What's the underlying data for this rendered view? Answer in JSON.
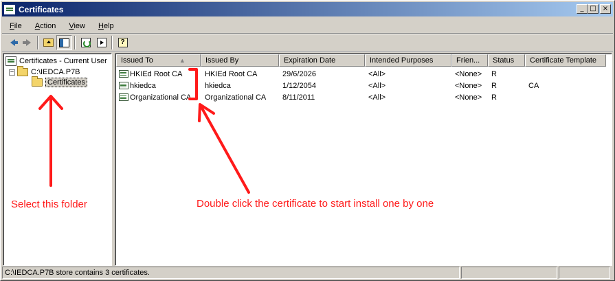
{
  "window": {
    "title": "Certificates",
    "controls": {
      "minimize": "_",
      "maximize": "□",
      "close": "×"
    }
  },
  "menu": [
    {
      "label": "File",
      "accel": "F",
      "rest": "ile"
    },
    {
      "label": "Action",
      "accel": "A",
      "rest": "ction"
    },
    {
      "label": "View",
      "accel": "V",
      "rest": "iew"
    },
    {
      "label": "Help",
      "accel": "H",
      "rest": "elp"
    }
  ],
  "tree": {
    "root": "Certificates - Current User",
    "file": "C:\\IEDCA.P7B",
    "folder": "Certificates",
    "expander": "−"
  },
  "columns": [
    "Issued To",
    "Issued By",
    "Expiration Date",
    "Intended Purposes",
    "Frien...",
    "Status",
    "Certificate Template"
  ],
  "sort_indicator": "▲",
  "rows": [
    {
      "issued_to": "HKIEd Root CA",
      "issued_by": "HKIEd Root CA",
      "expiration": "29/6/2026",
      "purposes": "<All>",
      "friendly": "<None>",
      "status": "R",
      "template": ""
    },
    {
      "issued_to": "hkiedca",
      "issued_by": "hkiedca",
      "expiration": "1/12/2054",
      "purposes": "<All>",
      "friendly": "<None>",
      "status": "R",
      "template": "CA"
    },
    {
      "issued_to": "Organizational CA",
      "issued_by": "Organizational CA",
      "expiration": "8/11/2011",
      "purposes": "<All>",
      "friendly": "<None>",
      "status": "R",
      "template": ""
    }
  ],
  "statusbar": {
    "message": "C:\\IEDCA.P7B store contains 3 certificates."
  },
  "annotations": {
    "left_note": "Select this folder",
    "right_note": "Double click the certificate to start install one by one",
    "color": "#ff1a1a"
  }
}
